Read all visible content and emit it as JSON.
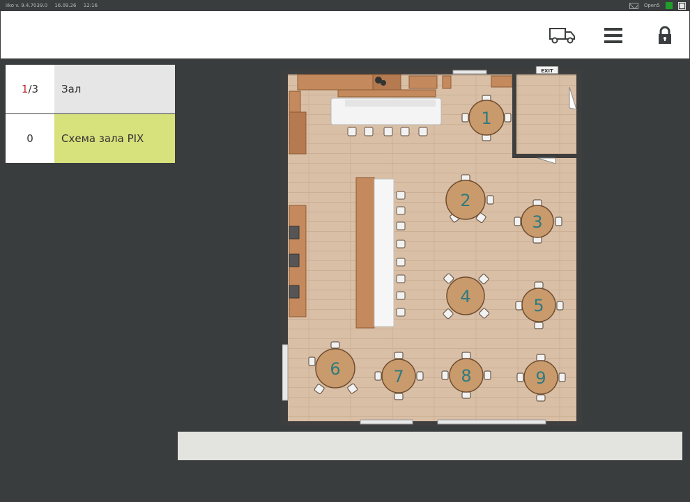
{
  "status_bar": {
    "app_version": "iiko  v. 9.4.7039.0",
    "date": "16.09.26",
    "time": "12:16",
    "user": "Open5"
  },
  "header": {
    "icons": [
      "truck-icon",
      "menu-icon",
      "lock-icon"
    ]
  },
  "halls": [
    {
      "number_current": "1",
      "number_total": "/3",
      "label": "Зал",
      "selected": false
    },
    {
      "number": "0",
      "label": "Схема зала PIX",
      "selected": true
    }
  ],
  "floor_plan": {
    "exit_label": "EXIT",
    "tables": [
      {
        "number": "1"
      },
      {
        "number": "2"
      },
      {
        "number": "3"
      },
      {
        "number": "4"
      },
      {
        "number": "5"
      },
      {
        "number": "6"
      },
      {
        "number": "7"
      },
      {
        "number": "8"
      },
      {
        "number": "9"
      }
    ]
  },
  "colors": {
    "background": "#3a3d3d",
    "selected_hall": "#d8e27c",
    "hall_row": "#e6e6e6",
    "accent_red": "#c0282d",
    "floor": "#d9bfa6",
    "table_fill": "#c99a6b",
    "table_number": "#2e7b80"
  }
}
